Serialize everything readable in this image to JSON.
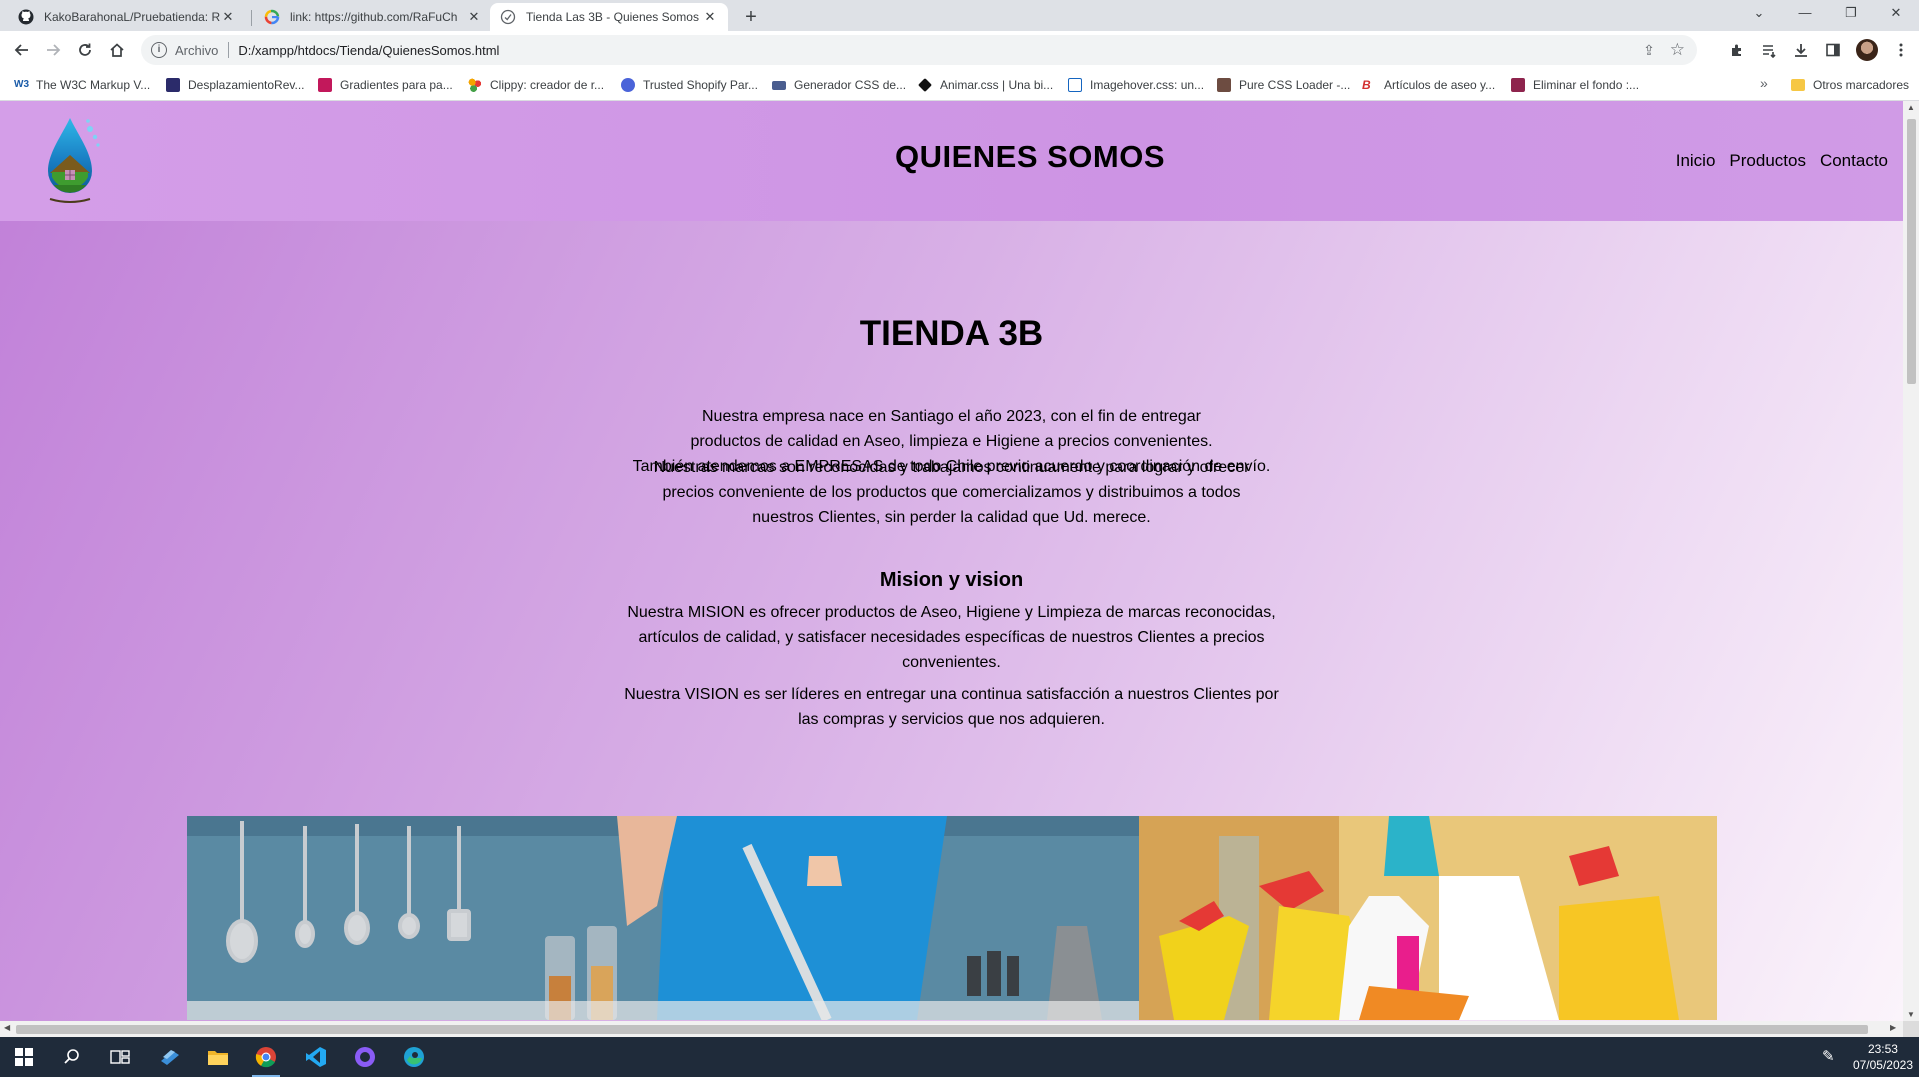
{
  "browser": {
    "tabs": [
      {
        "label": "KakoBarahonaL/Pruebatienda: Re",
        "favicon": "github-icon",
        "active": false
      },
      {
        "label": "link: https://github.com/RaFuCh",
        "favicon": "google-icon",
        "active": false
      },
      {
        "label": "Tienda Las 3B - Quienes Somos",
        "favicon": "page-icon",
        "active": true
      }
    ],
    "new_tab_label": "+",
    "address": {
      "protocol_label": "Archivo",
      "url": "D:/xampp/htdocs/Tienda/QuienesSomos.html"
    },
    "bookmarks": [
      {
        "label": "The W3C Markup V...",
        "color": "#1a5ba8"
      },
      {
        "label": "DesplazamientoRev...",
        "color": "#2b2b6a"
      },
      {
        "label": "Gradientes para pa...",
        "color": "#c2185b"
      },
      {
        "label": "Clippy: creador de r...",
        "color": "#f4a400"
      },
      {
        "label": "Trusted Shopify Par...",
        "color": "#4a63d9"
      },
      {
        "label": "Generador CSS de...",
        "color": "#4a5d8f"
      },
      {
        "label": "Animar.css | Una bi...",
        "color": "#111111"
      },
      {
        "label": "Imagehover.css: un...",
        "color": "#1565c0"
      },
      {
        "label": "Pure CSS Loader -...",
        "color": "#6d4c41"
      },
      {
        "label": "Artículos de aseo y...",
        "color": "#d32f2f"
      },
      {
        "label": "Eliminar el fondo :...",
        "color": "#8e244d"
      }
    ],
    "bookmarks_more": "»",
    "other_bookmarks": "Otros marcadores"
  },
  "site": {
    "header_title": "QUIENES SOMOS",
    "nav": [
      "Inicio",
      "Productos",
      "Contacto"
    ],
    "heading": "TIENDA 3B",
    "intro_lines": [
      "Nuestra empresa nace en Santiago el año 2023, con el fin de entregar",
      "productos de calidad en Aseo, limpieza e Higiene a precios convenientes.",
      "También atendemos a EMPRESAS de todo Chile previo acuerdo y coordinación de envío."
    ],
    "brands_lines": [
      "Nuestras marcas son reconocidas y trabajamos continuamente para lograr y ofrecer",
      "precios conveniente de los productos que comercializamos y distribuimos a todos",
      "nuestros Clientes, sin perder la calidad que Ud. merece."
    ],
    "mv_heading": "Mision y vision",
    "mision_lines": [
      "Nuestra MISION es ofrecer productos de Aseo, Higiene y Limpieza de marcas reconocidas,",
      "artículos de calidad, y satisfacer necesidades específicas de nuestros Clientes a precios",
      "convenientes."
    ],
    "vision_lines": [
      "Nuestra VISION es ser líderes en entregar una continua satisfacción a nuestros Clientes por",
      "las compras y servicios que nos adquieren."
    ]
  },
  "taskbar": {
    "time": "23:53",
    "date": "07/05/2023"
  }
}
